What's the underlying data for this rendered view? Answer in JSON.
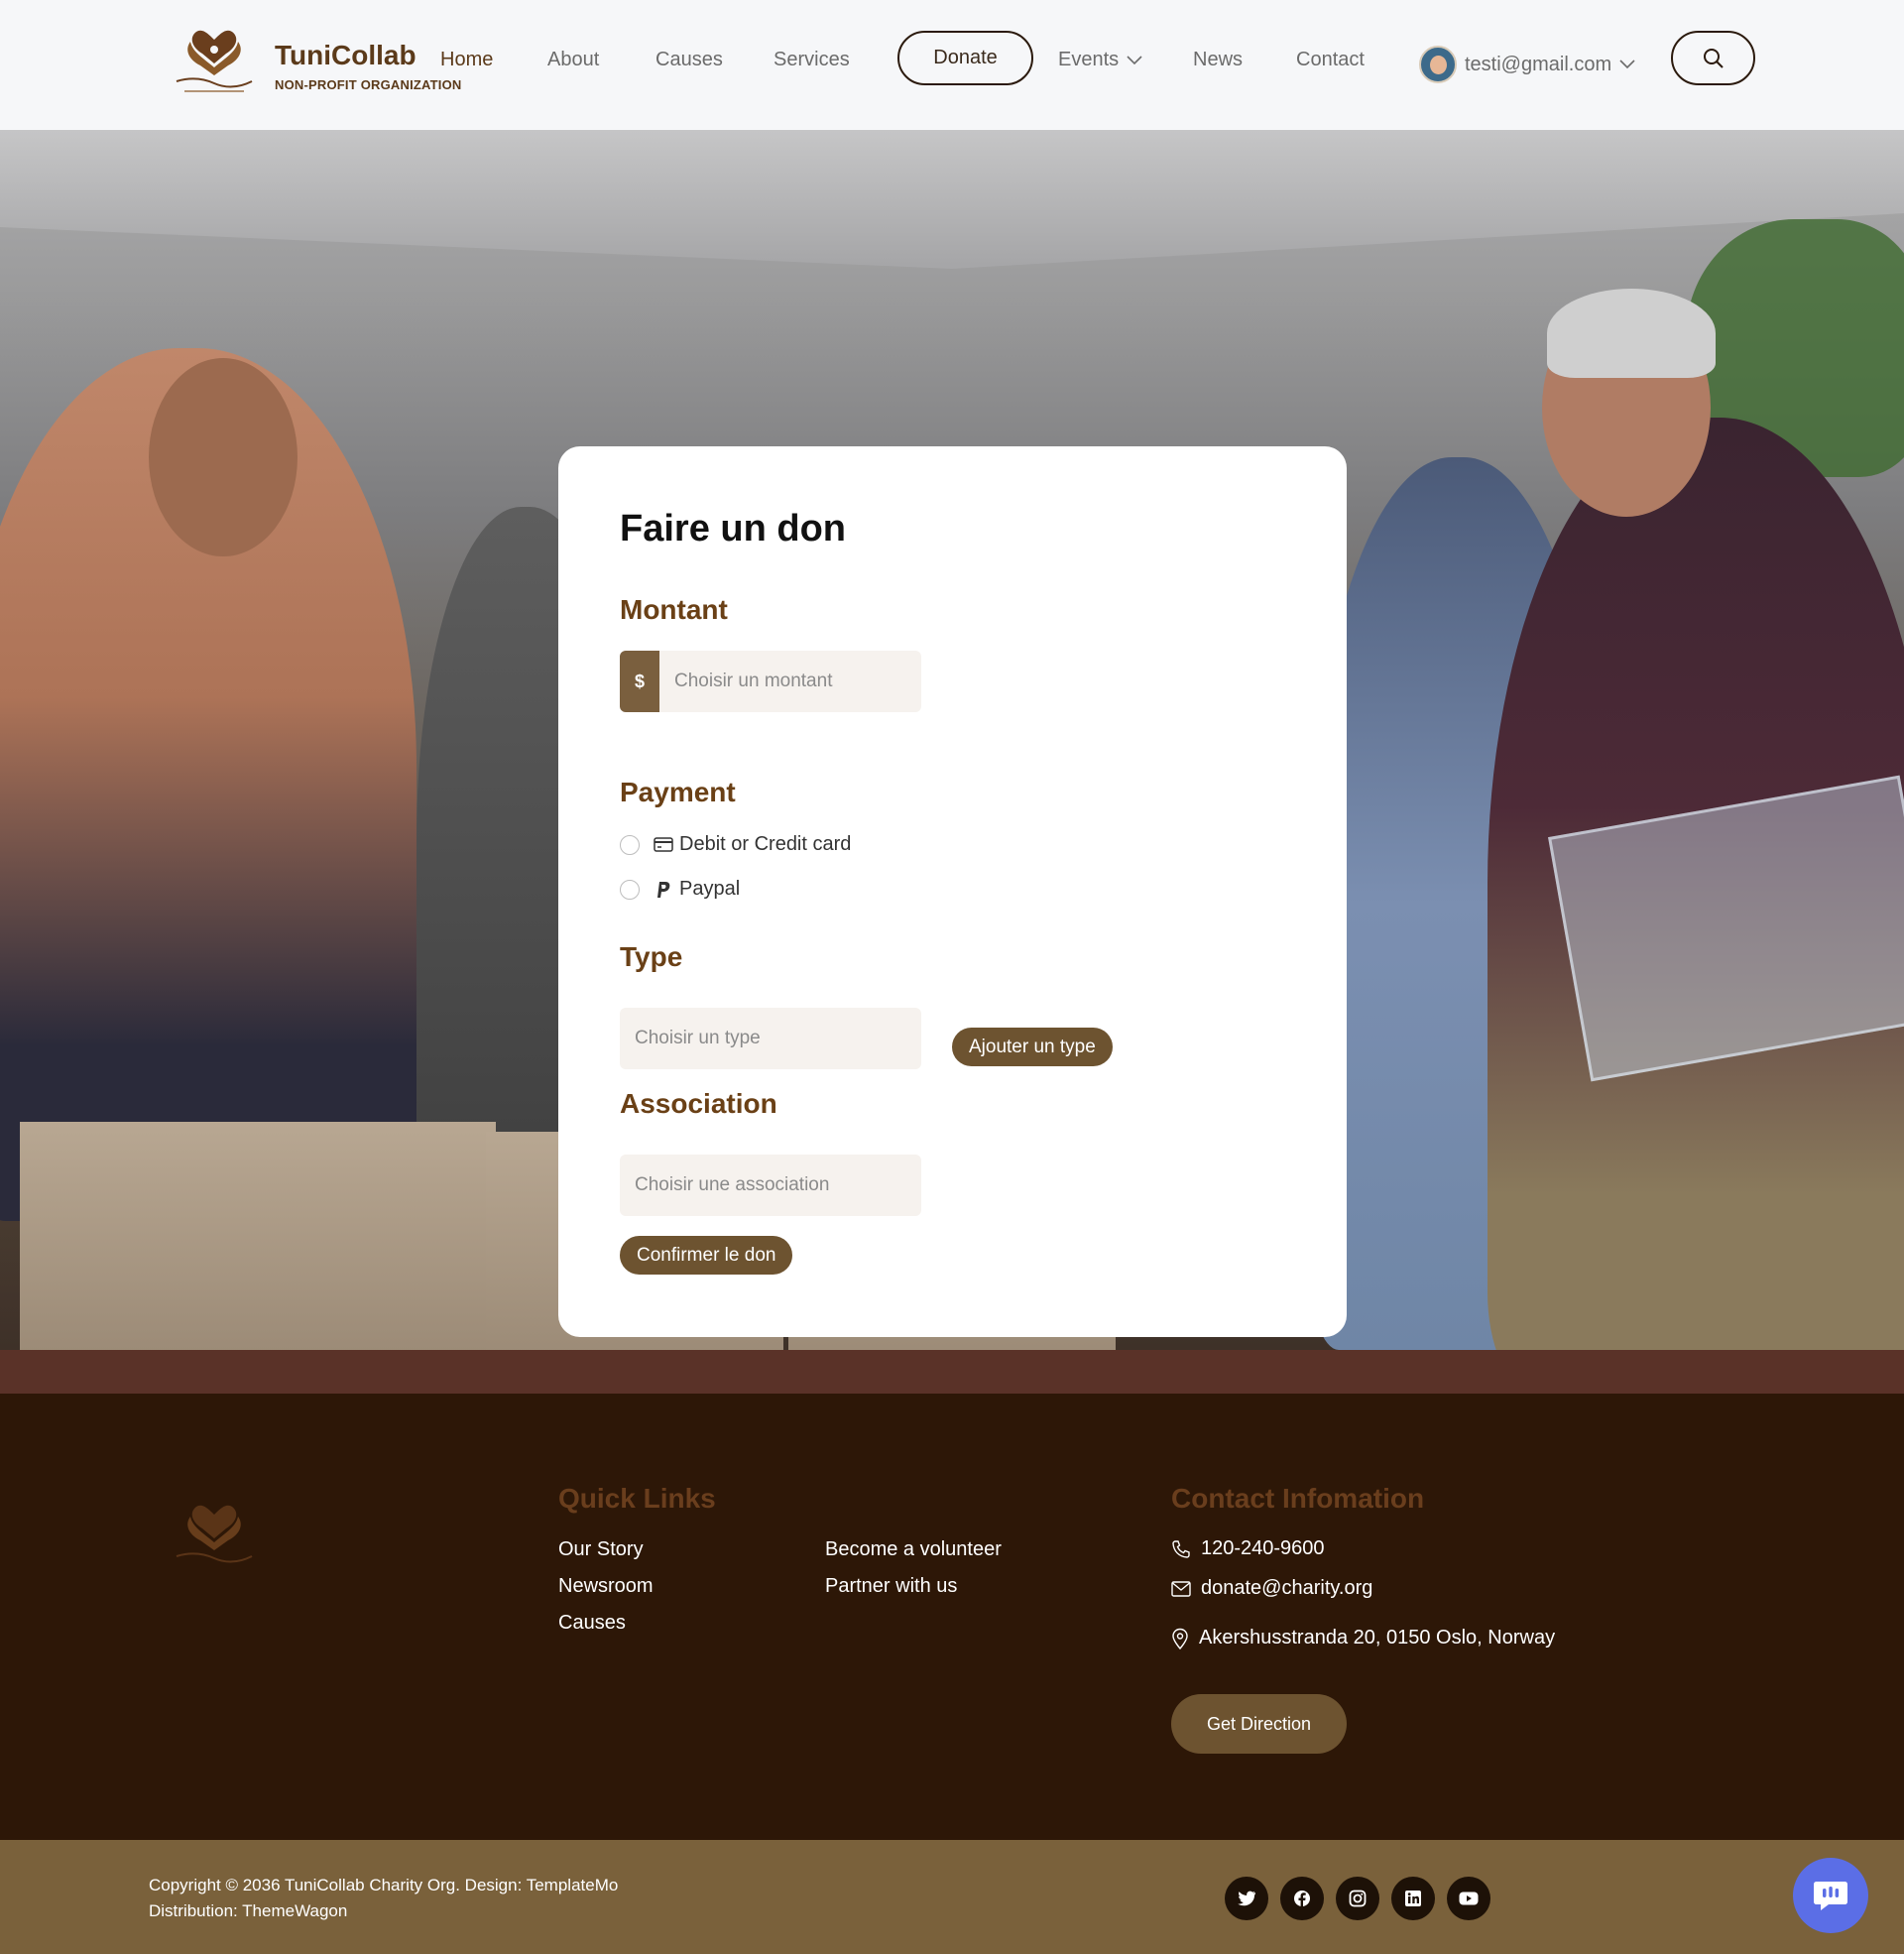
{
  "header": {
    "brand_name": "TuniCollab",
    "brand_subtitle": "NON-PROFIT ORGANIZATION",
    "nav": {
      "home": "Home",
      "about": "About",
      "causes": "Causes",
      "services": "Services",
      "donate": "Donate",
      "events": "Events",
      "news": "News",
      "contact": "Contact"
    },
    "user_email": "testi@gmail.com"
  },
  "donation_form": {
    "title": "Faire un don",
    "amount_label": "Montant",
    "currency_symbol": "$",
    "amount_placeholder": "Choisir un montant",
    "payment_label": "Payment",
    "payment_options": [
      "Debit or Credit card",
      "Paypal"
    ],
    "type_label": "Type",
    "type_placeholder": "Choisir un type",
    "add_type_button": "Ajouter un type",
    "association_label": "Association",
    "association_placeholder": "Choisir une association",
    "confirm_button": "Confirmer le don"
  },
  "footer": {
    "quick_links_heading": "Quick Links",
    "links": {
      "our_story": "Our Story",
      "newsroom": "Newsroom",
      "causes": "Causes",
      "become_volunteer": "Become a volunteer",
      "partner": "Partner with us"
    },
    "contact_heading": "Contact Infomation",
    "phone": "120-240-9600",
    "email": "donate@charity.org",
    "address": "Akershusstranda 20, 0150 Oslo, Norway",
    "get_direction": "Get Direction"
  },
  "bottom_bar": {
    "copyright_line1": "Copyright © 2036 TuniCollab Charity Org. Design: TemplateMo",
    "copyright_line2": "Distribution: ThemeWagon",
    "social_icons": [
      "twitter-icon",
      "facebook-icon",
      "instagram-icon",
      "linkedin-icon",
      "youtube-icon"
    ]
  },
  "colors": {
    "brand_brown": "#5b3a1a",
    "accent_button": "#6d5330",
    "footer_bg": "#2d1707",
    "bottom_bar_bg": "#7a613b",
    "chat_fab": "#5b6ee6"
  }
}
